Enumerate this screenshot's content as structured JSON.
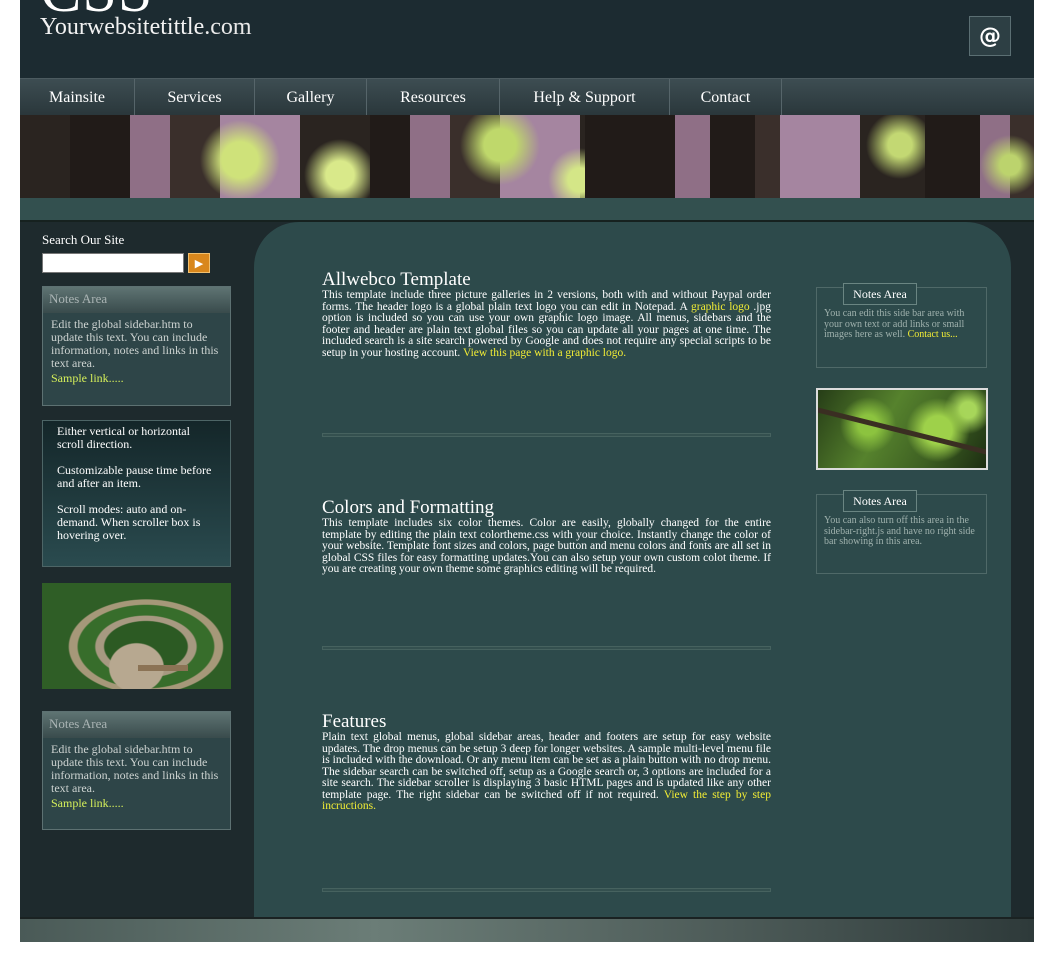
{
  "header": {
    "watermark": "CSS",
    "site_name": "Yourwebsitetittle",
    "site_domain": ".com",
    "email_icon": "@"
  },
  "nav": {
    "items": [
      {
        "label": "Mainsite"
      },
      {
        "label": "Services"
      },
      {
        "label": "Gallery"
      },
      {
        "label": "Resources"
      },
      {
        "label": "Help & Support"
      },
      {
        "label": "Contact"
      }
    ]
  },
  "left_sidebar": {
    "search": {
      "label": "Search Our Site",
      "value": "",
      "button_icon": "▶"
    },
    "notes_top": {
      "title": "Notes Area",
      "body": "Edit the global sidebar.htm to update this text. You can include information, notes and links in this text area.",
      "link": "Sample link....."
    },
    "scroller": {
      "items": [
        "Either vertical or horizontal scroll direction.",
        "Customizable pause time before and after an item.",
        "Scroll modes: auto and on-demand. When scroller box is hovering over."
      ]
    },
    "notes_bottom": {
      "title": "Notes Area",
      "body": "Edit the global sidebar.htm to update this text. You can include information, notes and links in this text area.",
      "link": "Sample link....."
    }
  },
  "main": {
    "articles": [
      {
        "title": "Allwebco Template",
        "text_a": "This template include three picture galleries in 2 versions, both with and without Paypal order forms. The header logo is a global plain text logo you can edit in Notepad. A ",
        "link_a": "graphic logo",
        "text_b": " .jpg option is included so you can use your own graphic logo image. All menus, sidebars and the footer and header are plain text global files so you can update all your pages at one time. The included search is a site search powered by Google and does not require any special scripts to be setup in your hosting account. ",
        "link_b": "View this page with a graphic logo."
      },
      {
        "title": "Colors and Formatting",
        "text_a": "This template includes six color themes. Color are easily, globally changed for the entire template by editing the plain text colortheme.css with your choice. Instantly change the color of your website. Template font sizes and colors, page button and menu colors and fonts are all set in global CSS files for easy formatting updates.You can also setup your own custom colot theme. If you are creating your own theme some graphics editing will be required."
      },
      {
        "title": "Features",
        "text_a": "Plain text global menus, global sidebar areas, header and footers are setup for easy website updates. The drop menus can be setup 3 deep for longer websites. A sample multi-level menu file is included with the download. Or any menu item can be set as a plain button with no drop menu. The sidebar search can be switched off, setup as a Google search or, 3 options are included for a site search. The sidebar scroller is displaying 3 basic HTML pages and is updated like any other template page. The right sidebar can be switched off if not required. ",
        "link_a": "View the step by step incructions."
      }
    ]
  },
  "right_sidebar": {
    "notes_top": {
      "title": "Notes Area",
      "body": "You can edit this side bar area with your own text or add links or small images here as well. ",
      "link": "Contact us..."
    },
    "notes_bottom": {
      "title": "Notes Area",
      "body": "You can also turn off this area in the sidebar-right.js and have no right side bar showing in this area."
    }
  },
  "colors": {
    "page_bg": "#1e2a2d",
    "content_bg": "#2d4a4b",
    "link_yellow": "#f2ed35",
    "link_green": "#d6f05a",
    "search_button": "#d9871c"
  }
}
